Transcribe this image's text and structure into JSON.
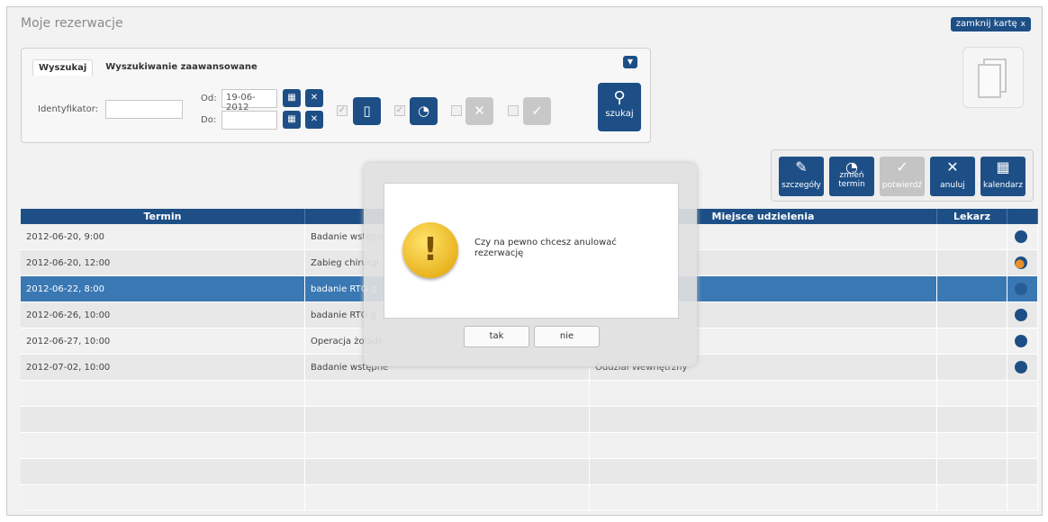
{
  "page": {
    "title": "Moje rezerwacje",
    "close_card": "zamknij kartę",
    "close_icon": "x"
  },
  "search": {
    "tabs": [
      "Wyszukaj",
      "Wyszukiwanie zaawansowane"
    ],
    "id_label": "Identyfikator:",
    "id_value": "",
    "from_label": "Od:",
    "from_value": "19-06-2012",
    "to_label": "Do:",
    "to_value": "",
    "search_label": "szukaj"
  },
  "toolbar": {
    "details": "szczegóły",
    "change_term_1": "zmień",
    "change_term_2": "termin",
    "confirm": "potwierdź",
    "cancel": "anuluj",
    "calendar": "kalendarz"
  },
  "grid": {
    "columns": [
      "Termin",
      "",
      "Miejsce udzielenia",
      "Lekarz",
      ""
    ],
    "rows": [
      {
        "term": "2012-06-20, 9:00",
        "service": "Badanie wstępne",
        "place": "",
        "doctor": ""
      },
      {
        "term": "2012-06-20, 12:00",
        "service": "Zabieg chirurgi",
        "place": "",
        "doctor": ""
      },
      {
        "term": "2012-06-22, 8:00",
        "service": "badanie RTG g",
        "place": "",
        "doctor": ""
      },
      {
        "term": "2012-06-26, 10:00",
        "service": "badanie RTG g",
        "place": "",
        "doctor": ""
      },
      {
        "term": "2012-06-27, 10:00",
        "service": "Operacja żołądk",
        "place": "",
        "doctor": ""
      },
      {
        "term": "2012-07-02, 10:00",
        "service": "Badanie wstępne",
        "place": "Oddział Wewnętrzny",
        "doctor": ""
      }
    ]
  },
  "dialog": {
    "message": "Czy na pewno chcesz anulować rezerwację",
    "yes": "tak",
    "no": "nie",
    "icon": "warning-icon"
  }
}
